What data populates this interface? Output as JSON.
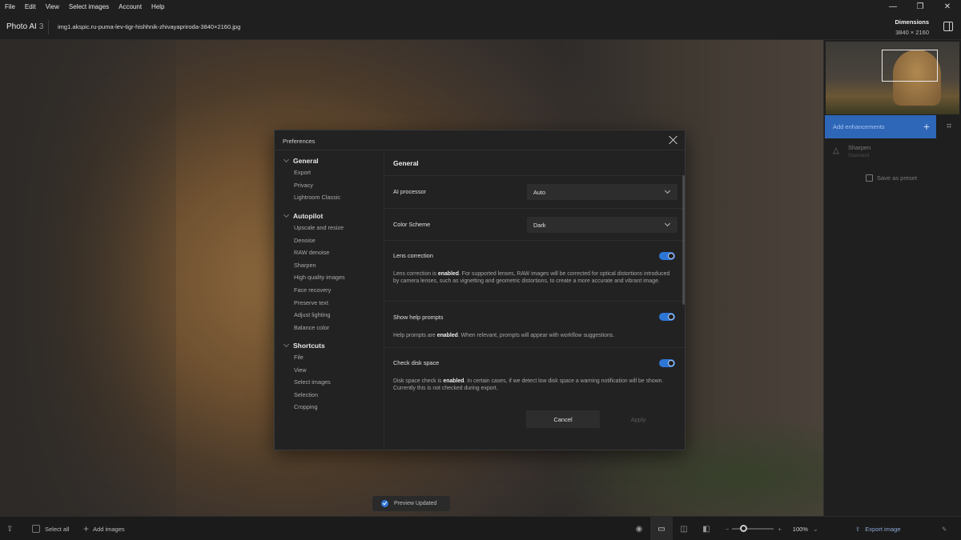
{
  "menubar": {
    "items": [
      "File",
      "Edit",
      "View",
      "Select images",
      "Account",
      "Help"
    ]
  },
  "window_controls": {
    "minimize": "—",
    "restore": "❐",
    "close": "✕"
  },
  "header": {
    "app_name": "Photo AI",
    "app_version": "3",
    "filename": "img1.akspic.ru-puma-lev-tigr-hishhnik-zhivayapriroda-3840×2160.jpg",
    "dimensions_label": "Dimensions",
    "dimensions_value": "3840 × 2160"
  },
  "right_panel": {
    "add_enhancements": "Add enhancements",
    "enhancement_name": "Sharpen",
    "enhancement_sub": "Standard",
    "save_preset": "Save as preset"
  },
  "toast": {
    "text": "Preview Updated"
  },
  "bottombar": {
    "select_all": "Select all",
    "add_images": "Add images",
    "zoom": "100%",
    "export": "Export image"
  },
  "dialog": {
    "title": "Preferences",
    "nav": {
      "groups": [
        {
          "label": "General",
          "items": [
            "Export",
            "Privacy",
            "Lightroom Classic"
          ]
        },
        {
          "label": "Autopilot",
          "items": [
            "Upscale and resize",
            "Denoise",
            "RAW denoise",
            "Sharpen",
            "High quality images",
            "Face recovery",
            "Preserve text",
            "Adjust lighting",
            "Balance color"
          ]
        },
        {
          "label": "Shortcuts",
          "items": [
            "File",
            "View",
            "Select images",
            "Selection",
            "Cropping"
          ]
        }
      ]
    },
    "content": {
      "title": "General",
      "ai_processor": {
        "label": "AI processor",
        "value": "Auto"
      },
      "color_scheme": {
        "label": "Color Scheme",
        "value": "Dark"
      },
      "lens": {
        "label": "Lens correction",
        "enabled": true,
        "desc_pre": "Lens correction is ",
        "desc_bold": "enabled",
        "desc_post": ". For supported lenses, RAW images will be corrected for optical distortions introduced by camera lenses, such as vignetting and geometric distortions, to create a more accurate and vibrant image."
      },
      "help": {
        "label": "Show help prompts",
        "enabled": true,
        "desc_pre": "Help prompts are ",
        "desc_bold": "enabled",
        "desc_post": ". When relevant, prompts will appear with workflow suggestions."
      },
      "disk": {
        "label": "Check disk space",
        "enabled": true,
        "desc_pre": "Disk space check is ",
        "desc_bold": "enabled",
        "desc_post": ". In certain cases, if we detect low disk space a warning notification will be shown. Currently this is not checked during export."
      },
      "cancel": "Cancel",
      "apply": "Apply"
    }
  },
  "colors": {
    "accent": "#2e76d6",
    "enhance_button": "#2e66b8",
    "background": "#1f1f1f",
    "dialog": "#222222"
  }
}
